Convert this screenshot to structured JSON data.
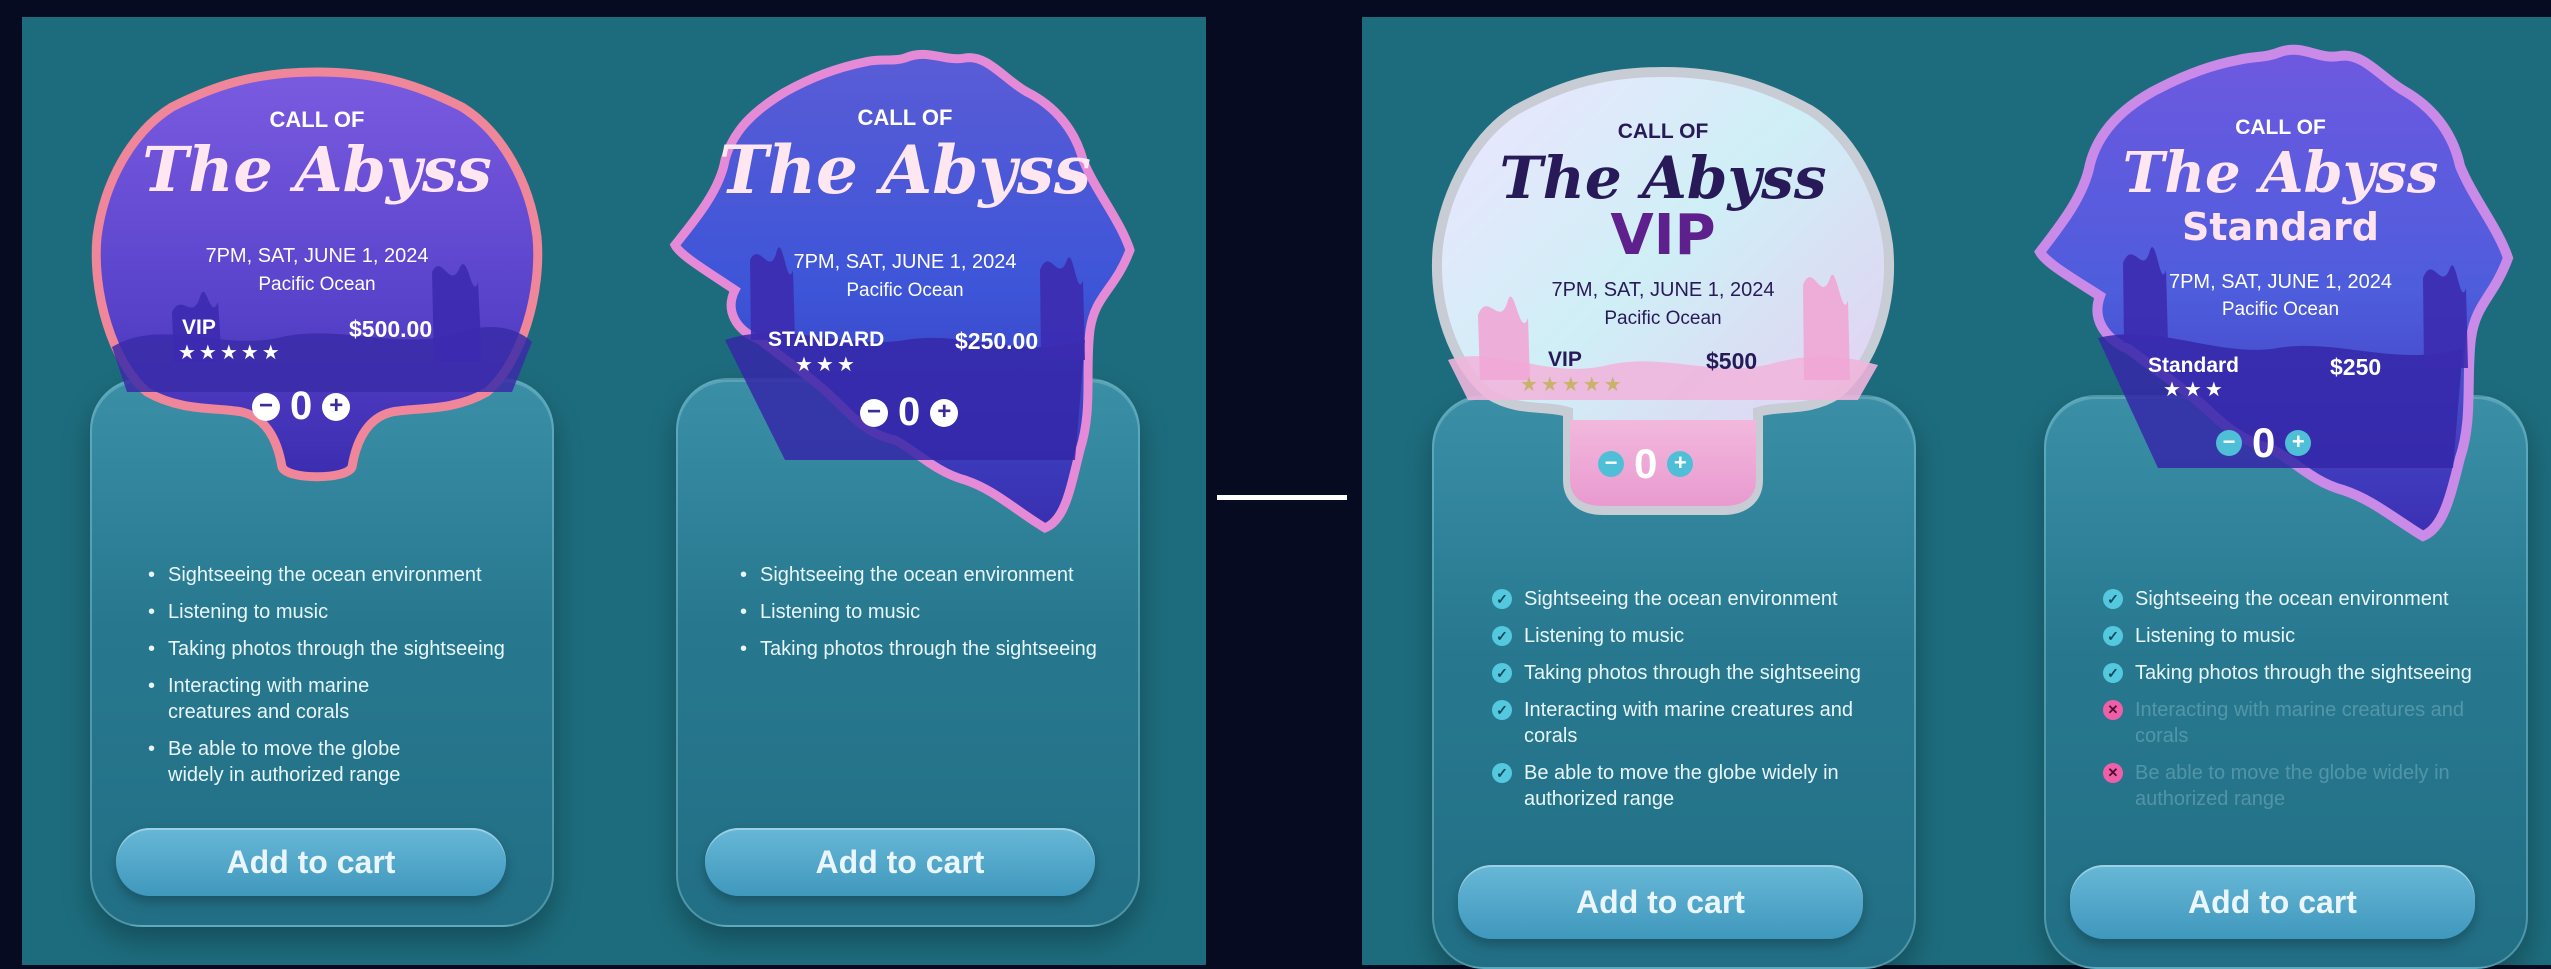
{
  "cards": [
    {
      "brand_call": "CALL OF",
      "brand_title": "The Abyss",
      "date": "7PM, SAT, JUNE 1, 2024",
      "venue": "Pacific Ocean",
      "tier": "VIP",
      "stars": "★★★★★",
      "price": "$500.00",
      "qty_minus": "−",
      "qty": "0",
      "qty_plus": "+",
      "features": [
        "Sightseeing the ocean environment",
        "Listening to music",
        "Taking photos through the sightseeing",
        "Interacting with marine creatures and corals",
        "Be able to move the globe widely in authorized range"
      ],
      "cart_label": "Add to cart"
    },
    {
      "brand_call": "CALL OF",
      "brand_title": "The Abyss",
      "date": "7PM, SAT, JUNE 1, 2024",
      "venue": "Pacific Ocean",
      "tier": "STANDARD",
      "stars": "★★★",
      "price": "$250.00",
      "qty_minus": "−",
      "qty": "0",
      "qty_plus": "+",
      "features": [
        "Sightseeing the ocean environment",
        "Listening to music",
        "Taking photos through the sightseeing"
      ],
      "cart_label": "Add to cart"
    },
    {
      "brand_call": "CALL OF",
      "brand_title": "The Abyss",
      "big_label": "VIP",
      "date": "7PM, SAT, JUNE 1, 2024",
      "venue": "Pacific Ocean",
      "tier": "VIP",
      "stars": "★★★★★",
      "price": "$500",
      "qty_minus": "−",
      "qty": "0",
      "qty_plus": "+",
      "features": [
        "Sightseeing the ocean environment",
        "Listening to music",
        "Taking photos through the sightseeing",
        "Interacting with marine creatures and corals",
        "Be able to move the globe widely in authorized range"
      ],
      "cart_label": "Add to cart"
    },
    {
      "brand_call": "CALL OF",
      "brand_title": "The Abyss",
      "big_label": "Standard",
      "date": "7PM, SAT, JUNE 1, 2024",
      "venue": "Pacific Ocean",
      "tier": "Standard",
      "stars": "★★★",
      "price": "$250",
      "qty_minus": "−",
      "qty": "0",
      "qty_plus": "+",
      "features": [
        "Sightseeing the ocean environment",
        "Listening to music",
        "Taking photos through the sightseeing",
        "Interacting with marine creatures and corals",
        "Be able to move the globe widely in authorized range"
      ],
      "cart_label": "Add to cart"
    }
  ],
  "colors": {
    "page_bg": "#060b22",
    "panel_bg": "#1d6c7d",
    "shell_purple": "#5b3fc8",
    "shell_blue": "#3b56d6",
    "border_coral": "#f0869a",
    "border_pink": "#e58ad6",
    "border_silver": "#c8ccd4",
    "border_lilac": "#c98ae8",
    "check": "#54c8de",
    "cross": "#ef5fa8"
  }
}
